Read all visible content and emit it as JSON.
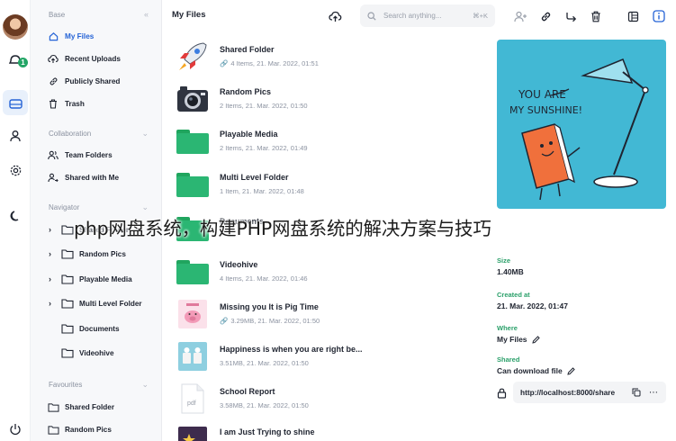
{
  "rail": {
    "notification_count": "1"
  },
  "sidebar": {
    "base_title": "Base",
    "base_items": [
      {
        "label": "My Files",
        "icon": "home-icon",
        "active": true
      },
      {
        "label": "Recent Uploads",
        "icon": "cloud-upload-icon"
      },
      {
        "label": "Publicly Shared",
        "icon": "link-icon"
      },
      {
        "label": "Trash",
        "icon": "trash-icon"
      }
    ],
    "collab_title": "Collaboration",
    "collab_items": [
      {
        "label": "Team Folders",
        "icon": "users-icon"
      },
      {
        "label": "Shared with Me",
        "icon": "user-shared-icon"
      }
    ],
    "navigator_title": "Navigator",
    "navigator_items": [
      {
        "label": "Shared Folder",
        "arrow": true
      },
      {
        "label": "Random Pics",
        "arrow": true
      },
      {
        "label": "Playable Media",
        "arrow": true
      },
      {
        "label": "Multi Level Folder",
        "arrow": true
      },
      {
        "label": "Documents",
        "arrow": false
      },
      {
        "label": "Videohive",
        "arrow": false
      }
    ],
    "favourites_title": "Favourites",
    "favourites_items": [
      {
        "label": "Shared Folder"
      },
      {
        "label": "Random Pics"
      }
    ]
  },
  "header": {
    "title": "My Files",
    "search_placeholder": "Search anything...",
    "search_shortcut": "⌘+K"
  },
  "files": [
    {
      "name": "Shared Folder",
      "meta": "4 Items, 21. Mar. 2022, 01:51",
      "shared": true,
      "thumb": "rocket"
    },
    {
      "name": "Random Pics",
      "meta": "2 Items, 21. Mar. 2022, 01:50",
      "shared": false,
      "thumb": "camera"
    },
    {
      "name": "Playable Media",
      "meta": "2 Items, 21. Mar. 2022, 01:49",
      "shared": false,
      "thumb": "folder"
    },
    {
      "name": "Multi Level Folder",
      "meta": "1 Item, 21. Mar. 2022, 01:48",
      "shared": false,
      "thumb": "folder"
    },
    {
      "name": "Documents",
      "meta": "",
      "shared": false,
      "thumb": "folder"
    },
    {
      "name": "Videohive",
      "meta": "4 Items, 21. Mar. 2022, 01:46",
      "shared": false,
      "thumb": "folder"
    },
    {
      "name": "Missing you It is Pig Time",
      "meta": "3.29MB, 21. Mar. 2022, 01:50",
      "shared": true,
      "thumb": "pig"
    },
    {
      "name": "Happiness is when you are right be...",
      "meta": "3.51MB, 21. Mar. 2022, 01:50",
      "shared": false,
      "thumb": "happy"
    },
    {
      "name": "School Report",
      "meta": "3.58MB, 21. Mar. 2022, 01:50",
      "shared": false,
      "thumb": "pdf"
    },
    {
      "name": "I am Just Trying to shine",
      "meta": "",
      "shared": false,
      "thumb": "shine"
    }
  ],
  "detail": {
    "preview_text_1": "YOU ARE",
    "preview_text_2": "MY SUNSHINE!",
    "size_label": "Size",
    "size_value": "1.40MB",
    "created_label": "Created at",
    "created_value": "21. Mar. 2022, 01:47",
    "where_label": "Where",
    "where_value": "My Files",
    "shared_label": "Shared",
    "shared_value": "Can download file",
    "share_url": "http://localhost:8000/share"
  },
  "pdf_label": "pdf",
  "watermark": "php网盘系统，构建PHP网盘系统的解决方案与技巧",
  "colors": {
    "accent": "#2563d6",
    "folder": "#2bb673",
    "preview_bg": "#42b8d4",
    "label_green": "#2ba06a"
  }
}
